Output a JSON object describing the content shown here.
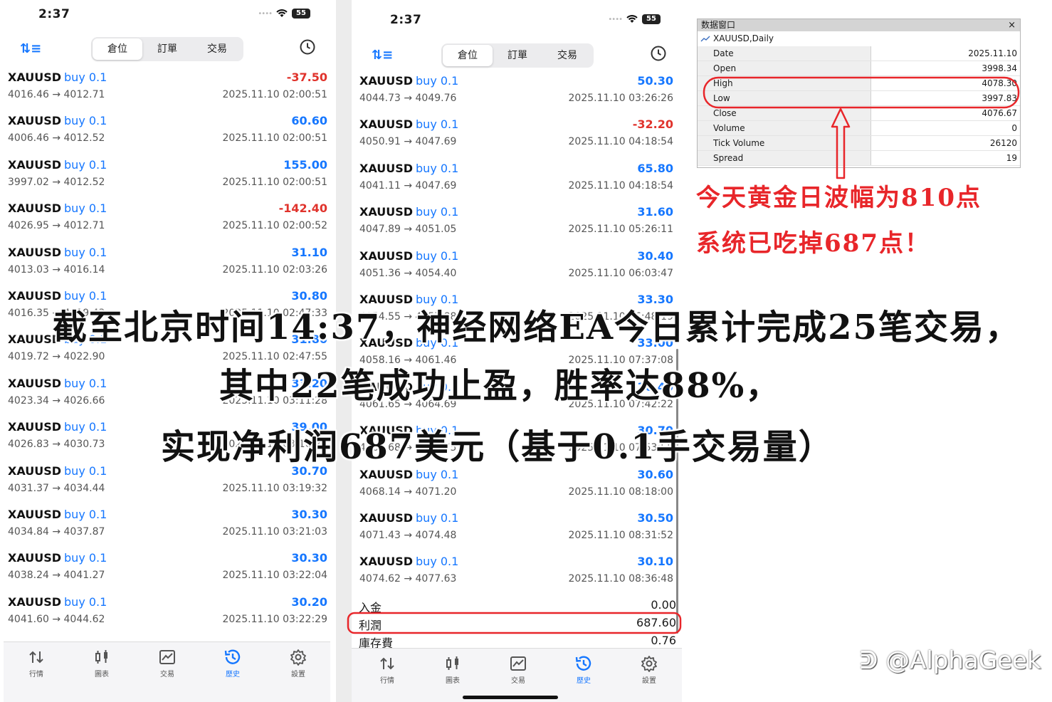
{
  "left_phone": {
    "status_time": "2:37",
    "battery": "55",
    "tabs": [
      "倉位",
      "訂單",
      "交易"
    ],
    "active_tab": 0,
    "trades": [
      {
        "symbol": "XAUUSD",
        "side": "buy 0.1",
        "profit": "-37.50",
        "prices": "4016.46 → 4012.71",
        "time": "2025.11.10 02:00:51"
      },
      {
        "symbol": "XAUUSD",
        "side": "buy 0.1",
        "profit": "60.60",
        "prices": "4006.46 → 4012.52",
        "time": "2025.11.10 02:00:51"
      },
      {
        "symbol": "XAUUSD",
        "side": "buy 0.1",
        "profit": "155.00",
        "prices": "3997.02 → 4012.52",
        "time": "2025.11.10 02:00:51"
      },
      {
        "symbol": "XAUUSD",
        "side": "buy 0.1",
        "profit": "-142.40",
        "prices": "4026.95 → 4012.71",
        "time": "2025.11.10 02:00:52"
      },
      {
        "symbol": "XAUUSD",
        "side": "buy 0.1",
        "profit": "31.10",
        "prices": "4013.03 → 4016.14",
        "time": "2025.11.10 02:03:26"
      },
      {
        "symbol": "XAUUSD",
        "side": "buy 0.1",
        "profit": "30.80",
        "prices": "4016.35 → 4019.43",
        "time": "2025.11.10 02:47:33"
      },
      {
        "symbol": "XAUUSD",
        "side": "buy 0.1",
        "profit": "31.80",
        "prices": "4019.72 → 4022.90",
        "time": "2025.11.10 02:47:55"
      },
      {
        "symbol": "XAUUSD",
        "side": "buy 0.1",
        "profit": "33.20",
        "prices": "4023.34 → 4026.66",
        "time": "2025.11.10 03:11:28"
      },
      {
        "symbol": "XAUUSD",
        "side": "buy 0.1",
        "profit": "39.00",
        "prices": "4026.83 → 4030.73",
        "time": "2025.11.10 03:16:21"
      },
      {
        "symbol": "XAUUSD",
        "side": "buy 0.1",
        "profit": "30.70",
        "prices": "4031.37 → 4034.44",
        "time": "2025.11.10 03:19:32"
      },
      {
        "symbol": "XAUUSD",
        "side": "buy 0.1",
        "profit": "30.30",
        "prices": "4034.84 → 4037.87",
        "time": "2025.11.10 03:21:03"
      },
      {
        "symbol": "XAUUSD",
        "side": "buy 0.1",
        "profit": "30.30",
        "prices": "4038.24 → 4041.27",
        "time": "2025.11.10 03:22:04"
      },
      {
        "symbol": "XAUUSD",
        "side": "buy 0.1",
        "profit": "30.20",
        "prices": "4041.60 → 4044.62",
        "time": "2025.11.10 03:22:29"
      }
    ],
    "bottom_tabs": [
      "行情",
      "圖表",
      "交易",
      "歷史",
      "設置"
    ],
    "active_bottom_tab": 3
  },
  "right_phone": {
    "status_time": "2:37",
    "battery": "55",
    "tabs": [
      "倉位",
      "訂單",
      "交易"
    ],
    "active_tab": 0,
    "trades": [
      {
        "symbol": "XAUUSD",
        "side": "buy 0.1",
        "profit": "50.30",
        "prices": "4044.73 → 4049.76",
        "time": "2025.11.10 03:26:26"
      },
      {
        "symbol": "XAUUSD",
        "side": "buy 0.1",
        "profit": "-32.20",
        "prices": "4050.91 → 4047.69",
        "time": "2025.11.10 04:18:54"
      },
      {
        "symbol": "XAUUSD",
        "side": "buy 0.1",
        "profit": "65.80",
        "prices": "4041.11 → 4047.69",
        "time": "2025.11.10 04:18:54"
      },
      {
        "symbol": "XAUUSD",
        "side": "buy 0.1",
        "profit": "31.60",
        "prices": "4047.89 → 4051.05",
        "time": "2025.11.10 05:26:11"
      },
      {
        "symbol": "XAUUSD",
        "side": "buy 0.1",
        "profit": "30.40",
        "prices": "4051.36 → 4054.40",
        "time": "2025.11.10 06:03:47"
      },
      {
        "symbol": "XAUUSD",
        "side": "buy 0.1",
        "profit": "33.30",
        "prices": "4054.55 → 4057.88",
        "time": "2025.11.10 06:48:19"
      },
      {
        "symbol": "XAUUSD",
        "side": "buy 0.1",
        "profit": "33.00",
        "prices": "4058.16 → 4061.46",
        "time": "2025.11.10 07:37:08"
      },
      {
        "symbol": "XAUUSD",
        "side": "buy 0.1",
        "profit": "30.40",
        "prices": "4061.65 → 4064.69",
        "time": "2025.11.10 07:42:22"
      },
      {
        "symbol": "XAUUSD",
        "side": "buy 0.1",
        "profit": "30.70",
        "prices": "4064.68 → 4067.75",
        "time": "2025.11.10 07:53:55"
      },
      {
        "symbol": "XAUUSD",
        "side": "buy 0.1",
        "profit": "30.60",
        "prices": "4068.14 → 4071.20",
        "time": "2025.11.10 08:18:00"
      },
      {
        "symbol": "XAUUSD",
        "side": "buy 0.1",
        "profit": "30.50",
        "prices": "4071.43 → 4074.48",
        "time": "2025.11.10 08:31:52"
      },
      {
        "symbol": "XAUUSD",
        "side": "buy 0.1",
        "profit": "30.10",
        "prices": "4074.62 → 4077.63",
        "time": "2025.11.10 08:36:48"
      }
    ],
    "summary": [
      {
        "label": "入金",
        "value": "0.00"
      },
      {
        "label": "利潤",
        "value": "687.60"
      },
      {
        "label": "庫存費",
        "value": "0.76"
      }
    ],
    "bottom_tabs": [
      "行情",
      "圖表",
      "交易",
      "歷史",
      "設置"
    ],
    "active_bottom_tab": 3
  },
  "data_window": {
    "title": "数据窗口",
    "close": "×",
    "symbol": "XAUUSD,Daily",
    "rows": [
      {
        "key": "Date",
        "value": "2025.11.10"
      },
      {
        "key": "Open",
        "value": "3998.34"
      },
      {
        "key": "High",
        "value": "4078.30"
      },
      {
        "key": "Low",
        "value": "3997.83"
      },
      {
        "key": "Close",
        "value": "4076.67"
      },
      {
        "key": "Volume",
        "value": "0"
      },
      {
        "key": "Tick Volume",
        "value": "26120"
      },
      {
        "key": "Spread",
        "value": "19"
      }
    ]
  },
  "annotations": {
    "line1": "今天黄金日波幅为810点",
    "line2": "系统已吃掉687点！"
  },
  "overlay": {
    "line1": "截至北京时间14:37，神经网络EA今日累计完成25笔交易，",
    "line2": "其中22笔成功止盈，胜率达88%，",
    "line3": "实现净利润687美元（基于0.1手交易量）"
  },
  "watermark": "@AlphaGeek",
  "colors": {
    "accent_blue": "#1677ff",
    "loss_red": "#e0332c",
    "annotation_red": "#e8262a"
  }
}
